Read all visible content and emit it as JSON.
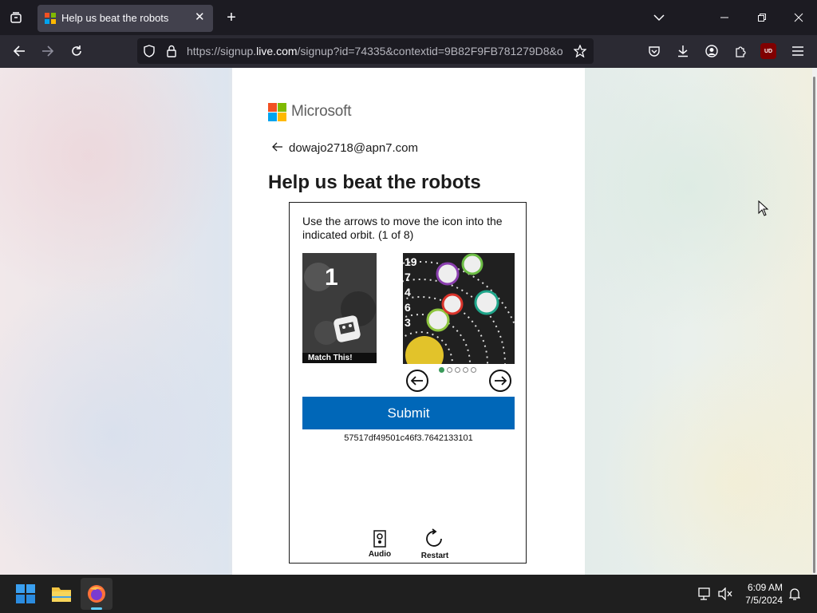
{
  "browser": {
    "tab_title": "Help us beat the robots",
    "url_prefix": "https://signup.",
    "url_domain": "live.com",
    "url_rest": "/signup?id=74335&contextid=9B82F9FB781279D8&o",
    "badge": "UD"
  },
  "page": {
    "brand": "Microsoft",
    "email": "dowajo2718@apn7.com",
    "heading": "Help us beat the robots"
  },
  "captcha": {
    "instruction": "Use the arrows to move the icon into the indicated orbit. (1 of 8)",
    "match_number": "1",
    "match_label": "Match This!",
    "orbit_labels": [
      "19",
      "7",
      "4",
      "6",
      "3"
    ],
    "selected_index": 1,
    "total_positions": 5,
    "submit_label": "Submit",
    "token": "57517df49501c46f3.7642133101",
    "audio_label": "Audio",
    "restart_label": "Restart"
  },
  "taskbar": {
    "time": "6:09 AM",
    "date": "7/5/2024"
  },
  "colors": {
    "submit": "#0067b8",
    "ms_red": "#f25022",
    "ms_green": "#7fba00",
    "ms_blue": "#00a4ef",
    "ms_yellow": "#ffb900",
    "dot_active": "#3a9a5a"
  }
}
